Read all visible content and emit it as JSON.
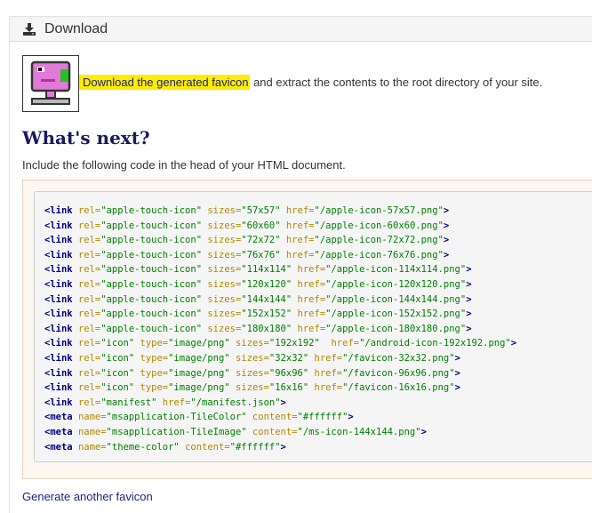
{
  "panel": {
    "title": "Download",
    "icon": "download-icon"
  },
  "download": {
    "link_text": "Download the generated favicon",
    "rest_text": " and extract the contents to the root directory of your site.",
    "favicon_colors": {
      "body": "#e27ad8",
      "accent": "#22c222",
      "outline": "#333333"
    }
  },
  "next": {
    "heading": "What's next?",
    "intro": "Include the following code in the head of your HTML document."
  },
  "code_lines": [
    {
      "tag": "link",
      "attrs": [
        [
          "rel",
          "apple-touch-icon"
        ],
        [
          "sizes",
          "57x57"
        ],
        [
          "href",
          "/apple-icon-57x57.png"
        ]
      ]
    },
    {
      "tag": "link",
      "attrs": [
        [
          "rel",
          "apple-touch-icon"
        ],
        [
          "sizes",
          "60x60"
        ],
        [
          "href",
          "/apple-icon-60x60.png"
        ]
      ]
    },
    {
      "tag": "link",
      "attrs": [
        [
          "rel",
          "apple-touch-icon"
        ],
        [
          "sizes",
          "72x72"
        ],
        [
          "href",
          "/apple-icon-72x72.png"
        ]
      ]
    },
    {
      "tag": "link",
      "attrs": [
        [
          "rel",
          "apple-touch-icon"
        ],
        [
          "sizes",
          "76x76"
        ],
        [
          "href",
          "/apple-icon-76x76.png"
        ]
      ]
    },
    {
      "tag": "link",
      "attrs": [
        [
          "rel",
          "apple-touch-icon"
        ],
        [
          "sizes",
          "114x114"
        ],
        [
          "href",
          "/apple-icon-114x114.png"
        ]
      ]
    },
    {
      "tag": "link",
      "attrs": [
        [
          "rel",
          "apple-touch-icon"
        ],
        [
          "sizes",
          "120x120"
        ],
        [
          "href",
          "/apple-icon-120x120.png"
        ]
      ]
    },
    {
      "tag": "link",
      "attrs": [
        [
          "rel",
          "apple-touch-icon"
        ],
        [
          "sizes",
          "144x144"
        ],
        [
          "href",
          "/apple-icon-144x144.png"
        ]
      ]
    },
    {
      "tag": "link",
      "attrs": [
        [
          "rel",
          "apple-touch-icon"
        ],
        [
          "sizes",
          "152x152"
        ],
        [
          "href",
          "/apple-icon-152x152.png"
        ]
      ]
    },
    {
      "tag": "link",
      "attrs": [
        [
          "rel",
          "apple-touch-icon"
        ],
        [
          "sizes",
          "180x180"
        ],
        [
          "href",
          "/apple-icon-180x180.png"
        ]
      ]
    },
    {
      "tag": "link",
      "attrs": [
        [
          "rel",
          "icon"
        ],
        [
          "type",
          "image/png"
        ],
        [
          "sizes",
          "192x192"
        ],
        [
          "href",
          "/android-icon-192x192.png"
        ]
      ],
      "gap": "  "
    },
    {
      "tag": "link",
      "attrs": [
        [
          "rel",
          "icon"
        ],
        [
          "type",
          "image/png"
        ],
        [
          "sizes",
          "32x32"
        ],
        [
          "href",
          "/favicon-32x32.png"
        ]
      ]
    },
    {
      "tag": "link",
      "attrs": [
        [
          "rel",
          "icon"
        ],
        [
          "type",
          "image/png"
        ],
        [
          "sizes",
          "96x96"
        ],
        [
          "href",
          "/favicon-96x96.png"
        ]
      ]
    },
    {
      "tag": "link",
      "attrs": [
        [
          "rel",
          "icon"
        ],
        [
          "type",
          "image/png"
        ],
        [
          "sizes",
          "16x16"
        ],
        [
          "href",
          "/favicon-16x16.png"
        ]
      ]
    },
    {
      "tag": "link",
      "attrs": [
        [
          "rel",
          "manifest"
        ],
        [
          "href",
          "/manifest.json"
        ]
      ]
    },
    {
      "tag": "meta",
      "attrs": [
        [
          "name",
          "msapplication-TileColor"
        ],
        [
          "content",
          "#ffffff"
        ]
      ]
    },
    {
      "tag": "meta",
      "attrs": [
        [
          "name",
          "msapplication-TileImage"
        ],
        [
          "content",
          "/ms-icon-144x144.png"
        ]
      ]
    },
    {
      "tag": "meta",
      "attrs": [
        [
          "name",
          "theme-color"
        ],
        [
          "content",
          "#ffffff"
        ]
      ]
    }
  ],
  "footer": {
    "generate_link": "Generate another favicon"
  }
}
